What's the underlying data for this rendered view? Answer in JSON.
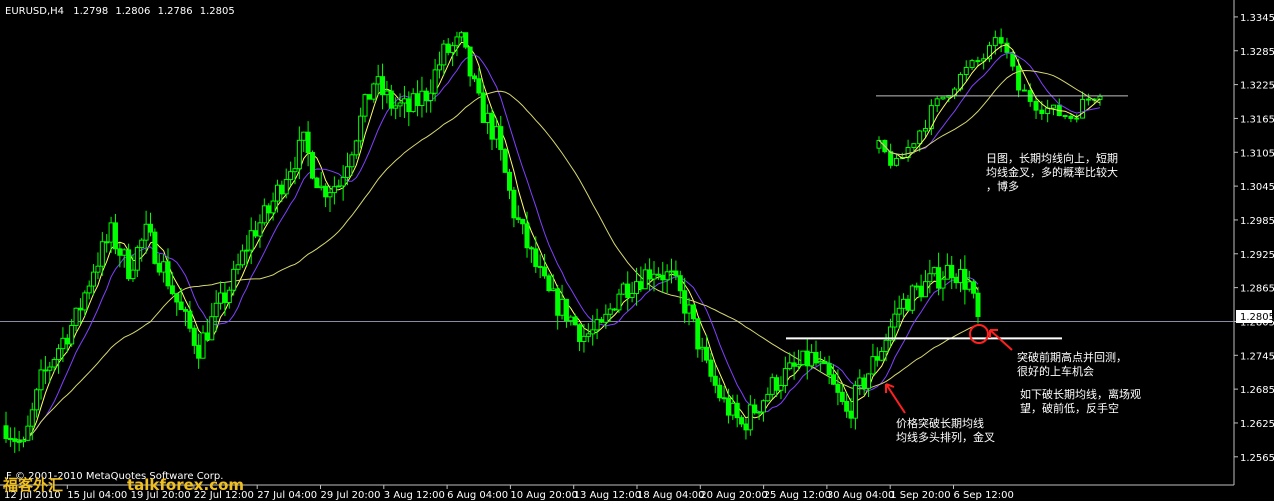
{
  "header": {
    "symbol": "EURUSD,H4",
    "open": "1.2798",
    "high": "1.2806",
    "low": "1.2786",
    "close": "1.2805"
  },
  "copyright": "© 2001-2010 MetaQuotes Software Corp.",
  "watermark": {
    "cn": "福客外汇",
    "site": "talkforex.com"
  },
  "annotations": {
    "daily_note": [
      "日图，长期均线向上，短期",
      "均线金叉，多的概率比较大",
      "，博多"
    ],
    "breakout_note": [
      "突破前期高点并回测，",
      "很好的上车机会"
    ],
    "breakdown_note": [
      "如下破长期均线，离场观",
      "望，破前低，反手空"
    ],
    "cross_note": [
      "价格突破长期均线",
      "均线多头排列，金叉"
    ]
  },
  "colors": {
    "background": "#000000",
    "bull": "#00ff00",
    "bear": "#00ff00",
    "ma_fast": "#ffff66",
    "ma_mid": "#8040ff",
    "ma_slow": "#d8d870",
    "support_line": "#ffffff",
    "price_line": "#9090a0",
    "arrow": "#ff2020"
  },
  "chart_data": {
    "type": "candlestick",
    "title": "EURUSD,H4",
    "ylim": [
      1.2515,
      1.3375
    ],
    "y_ticks": [
      "1.3345",
      "1.3285",
      "1.3225",
      "1.3165",
      "1.3105",
      "1.3045",
      "1.2985",
      "1.2925",
      "1.2865",
      "1.2805",
      "1.2745",
      "1.2685",
      "1.2625",
      "1.2565"
    ],
    "x_ticks": [
      "12 Jul 2010",
      "15 Jul 04:00",
      "19 Jul 20:00",
      "22 Jul 12:00",
      "27 Jul 04:00",
      "29 Jul 20:00",
      "3 Aug 12:00",
      "6 Aug 04:00",
      "10 Aug 20:00",
      "13 Aug 12:00",
      "18 Aug 04:00",
      "20 Aug 20:00",
      "25 Aug 12:00",
      "30 Aug 04:00",
      "1 Sep 20:00",
      "6 Sep 12:00"
    ],
    "current_price": "1.2805",
    "price_path": [
      [
        0,
        1.262
      ],
      [
        4,
        1.258
      ],
      [
        8,
        1.27
      ],
      [
        12,
        1.276
      ],
      [
        16,
        1.281
      ],
      [
        20,
        1.29
      ],
      [
        24,
        1.296
      ],
      [
        28,
        1.29
      ],
      [
        32,
        1.296
      ],
      [
        36,
        1.29
      ],
      [
        40,
        1.282
      ],
      [
        44,
        1.276
      ],
      [
        48,
        1.282
      ],
      [
        52,
        1.288
      ],
      [
        56,
        1.296
      ],
      [
        60,
        1.3
      ],
      [
        64,
        1.307
      ],
      [
        68,
        1.312
      ],
      [
        72,
        1.304
      ],
      [
        76,
        1.305
      ],
      [
        80,
        1.314
      ],
      [
        84,
        1.323
      ],
      [
        88,
        1.319
      ],
      [
        92,
        1.318
      ],
      [
        96,
        1.321
      ],
      [
        100,
        1.328
      ],
      [
        104,
        1.33
      ],
      [
        108,
        1.319
      ],
      [
        112,
        1.313
      ],
      [
        116,
        1.3
      ],
      [
        120,
        1.292
      ],
      [
        124,
        1.285
      ],
      [
        128,
        1.282
      ],
      [
        132,
        1.278
      ],
      [
        136,
        1.279
      ],
      [
        140,
        1.286
      ],
      [
        144,
        1.288
      ],
      [
        148,
        1.29
      ],
      [
        152,
        1.288
      ],
      [
        156,
        1.282
      ],
      [
        160,
        1.272
      ],
      [
        164,
        1.266
      ],
      [
        168,
        1.262
      ],
      [
        172,
        1.266
      ],
      [
        176,
        1.27
      ],
      [
        180,
        1.272
      ],
      [
        184,
        1.274
      ],
      [
        188,
        1.27
      ],
      [
        192,
        1.264
      ],
      [
        196,
        1.27
      ],
      [
        200,
        1.276
      ],
      [
        204,
        1.283
      ],
      [
        208,
        1.286
      ],
      [
        212,
        1.288
      ],
      [
        216,
        1.29
      ],
      [
        220,
        1.287
      ],
      [
        222,
        1.2805
      ]
    ],
    "inset": {
      "label": "日图",
      "price_path": [
        [
          0,
          1.31
        ],
        [
          3,
          1.306
        ],
        [
          6,
          1.312
        ],
        [
          9,
          1.318
        ],
        [
          12,
          1.323
        ],
        [
          15,
          1.327
        ],
        [
          18,
          1.33
        ],
        [
          21,
          1.334
        ],
        [
          24,
          1.323
        ],
        [
          27,
          1.32
        ],
        [
          30,
          1.318
        ],
        [
          33,
          1.317
        ],
        [
          36,
          1.321
        ],
        [
          38,
          1.323
        ]
      ],
      "horizontal_level": 1.3215
    },
    "support_level": 1.2775
  }
}
